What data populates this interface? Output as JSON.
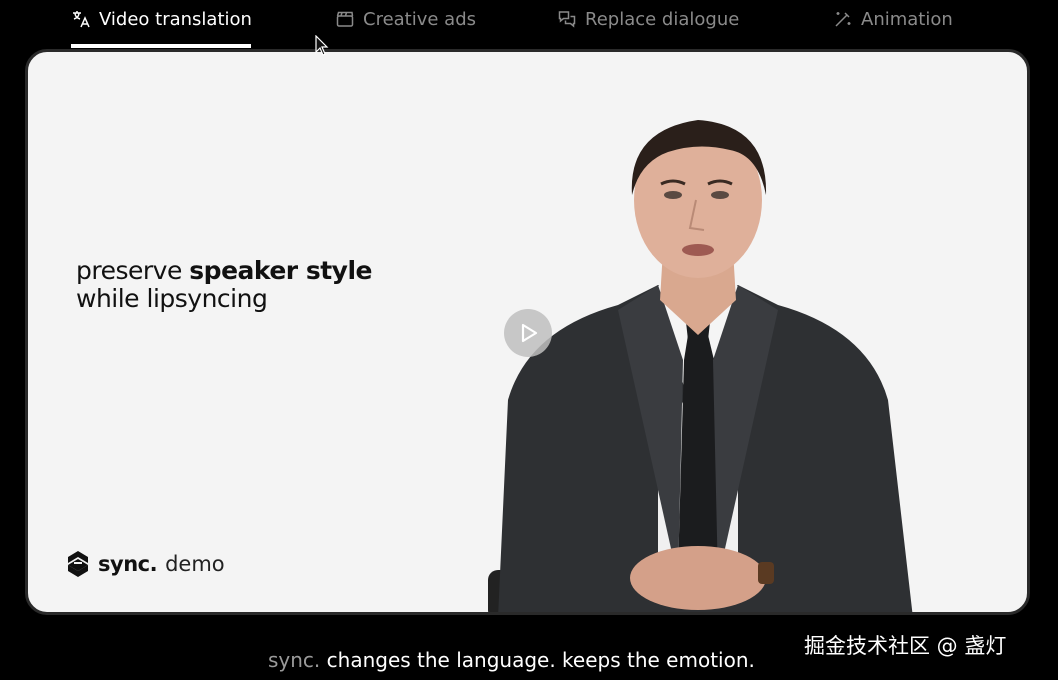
{
  "tabs": [
    {
      "label": "Video translation",
      "icon": "translate-icon",
      "active": true
    },
    {
      "label": "Creative ads",
      "icon": "clapperboard-icon",
      "active": false
    },
    {
      "label": "Replace dialogue",
      "icon": "chat-bubbles-icon",
      "active": false
    },
    {
      "label": "Animation",
      "icon": "wand-icon",
      "active": false
    }
  ],
  "stage": {
    "headline_line1_normal": "preserve ",
    "headline_line1_bold": "speaker style",
    "headline_line2": "while lipsyncing",
    "brand_name": "sync.",
    "brand_sub": "demo",
    "play_icon": "play-icon"
  },
  "caption": {
    "brand": "sync.",
    "text": " changes the language. keeps the emotion."
  },
  "watermark": "掘金技术社区 @ 盏灯",
  "colors": {
    "background": "#000000",
    "stage": "#f4f4f4",
    "active_tab": "#ffffff",
    "inactive_tab": "#8a8a8a"
  }
}
